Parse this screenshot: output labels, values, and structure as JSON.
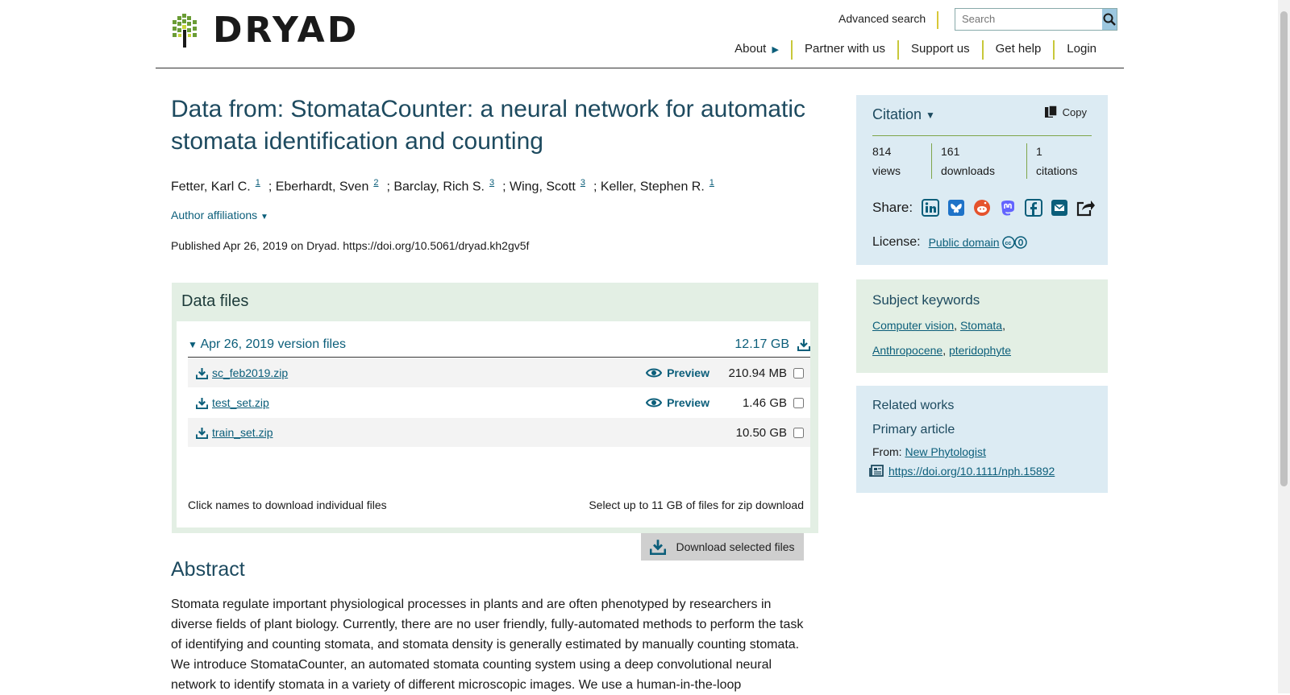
{
  "header": {
    "logo_text": "DRYAD",
    "advanced_search": "Advanced search",
    "search_placeholder": "Search",
    "nav": [
      "About",
      "Partner with us",
      "Support us",
      "Get help",
      "Login"
    ]
  },
  "dataset": {
    "title": "Data from: StomataCounter: a neural network for automatic stomata identification and counting",
    "authors": [
      {
        "name": "Fetter, Karl C.",
        "aff": "1"
      },
      {
        "name": "Eberhardt, Sven",
        "aff": "2"
      },
      {
        "name": "Barclay, Rich S.",
        "aff": "3"
      },
      {
        "name": "Wing, Scott",
        "aff": "3"
      },
      {
        "name": "Keller, Stephen R.",
        "aff": "1"
      }
    ],
    "affiliations_toggle": "Author affiliations",
    "published": "Published Apr 26, 2019 on Dryad. https://doi.org/10.5061/dryad.kh2gv5f"
  },
  "data_files": {
    "title": "Data files",
    "version_label": "Apr 26, 2019 version files",
    "total_size": "12.17 GB",
    "files": [
      {
        "name": "sc_feb2019.zip",
        "preview": "Preview",
        "size": "210.94 MB"
      },
      {
        "name": "test_set.zip",
        "preview": "Preview",
        "size": "1.46 GB"
      },
      {
        "name": "train_set.zip",
        "preview": "",
        "size": "10.50 GB"
      }
    ],
    "click_note": "Click names to download individual files",
    "select_note": "Select up to 11 GB of files for zip download",
    "download_selected": "Download selected files"
  },
  "abstract": {
    "heading": "Abstract",
    "text": "Stomata regulate important physiological processes in plants and are often phenotyped by researchers in diverse fields of plant biology. Currently, there are no user friendly, fully-automated methods to perform the task of identifying and counting stomata, and stomata density is generally estimated by manually counting stomata. We introduce StomataCounter, an automated stomata counting system using a deep convolutional neural network to identify stomata in a variety of different microscopic images. We use a human-in-the-loop"
  },
  "citation": {
    "title": "Citation",
    "copy": "Copy",
    "views_count": "814",
    "views_label": "views",
    "downloads_count": "161",
    "downloads_label": "downloads",
    "citations_count": "1",
    "citations_label": "citations",
    "share_label": "Share:",
    "license_label": "License:",
    "license_value": "Public domain"
  },
  "keywords": {
    "title": "Subject keywords",
    "items": [
      "Computer vision",
      "Stomata",
      "Anthropocene",
      "pteridophyte"
    ]
  },
  "related": {
    "title": "Related works",
    "primary": "Primary article",
    "from_label": "From:",
    "journal": "New Phytologist",
    "doi": "https://doi.org/10.1111/nph.15892"
  },
  "colors": {
    "accent": "#0b5e7a",
    "title": "#1d4a5f",
    "green_panel": "#e3efe4",
    "blue_panel": "#dcebf3",
    "nav_divider": "#c8c83a"
  }
}
